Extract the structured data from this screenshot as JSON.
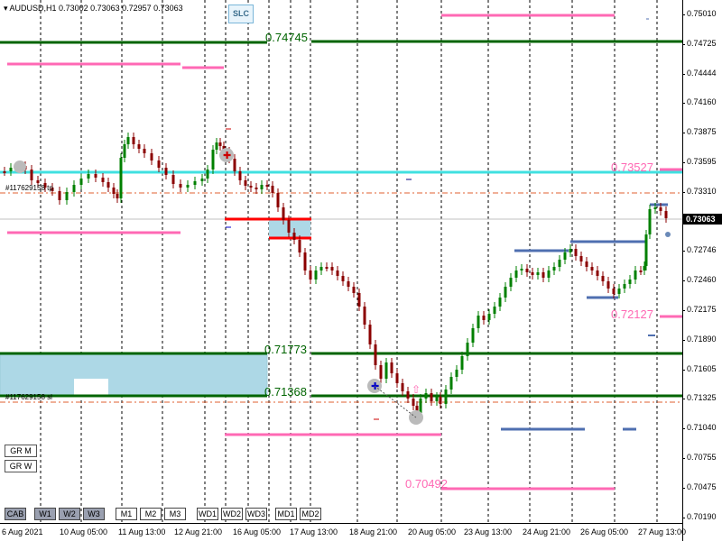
{
  "header": {
    "symbol_text": "AUDUSD,H1  0.73002 0.73063 0.72957 0.73063"
  },
  "toolbar": {
    "slc_label": "SLC"
  },
  "price_axis": {
    "ticks": [
      "0.75010",
      "0.74725",
      "0.74444",
      "0.74160",
      "0.73875",
      "0.73595",
      "0.73310",
      "0.73025",
      "0.72746",
      "0.72460",
      "0.72175",
      "0.71890",
      "0.71605",
      "0.71325",
      "0.71040",
      "0.70755",
      "0.70475",
      "0.70190"
    ],
    "current_price": "0.73063"
  },
  "time_axis": {
    "ticks": [
      "6 Aug 2021",
      "10 Aug 05:00",
      "11 Aug 13:00",
      "12 Aug 21:00",
      "16 Aug 05:00",
      "17 Aug 13:00",
      "18 Aug 21:00",
      "20 Aug 05:00",
      "23 Aug 13:00",
      "24 Aug 21:00",
      "26 Aug 05:00",
      "27 Aug 13:00"
    ]
  },
  "levels": {
    "green_top": "0.74745",
    "cyan": "0.73527",
    "green_mid": "0.71773",
    "green_low": "0.71368",
    "pink_mid": "0.72127",
    "pink_low": "0.70492"
  },
  "small_labels": {
    "upper": "#117629158 tp",
    "lower": "#117629158 sl"
  },
  "side_buttons": [
    "GR M",
    "GR W"
  ],
  "tf_buttons": [
    "CAB",
    "W1",
    "W2",
    "W3",
    "M1",
    "M2",
    "M3",
    "WD1",
    "WD2",
    "WD3",
    "MD1",
    "MD2"
  ],
  "colors": {
    "green": "#006400",
    "cyan": "#40e0e0",
    "pink": "#ff69b4",
    "red": "#ff0000",
    "blue": "#4f6fb0",
    "zone": "#add8e6",
    "bull": "#008000",
    "bear": "#8b0000"
  }
}
